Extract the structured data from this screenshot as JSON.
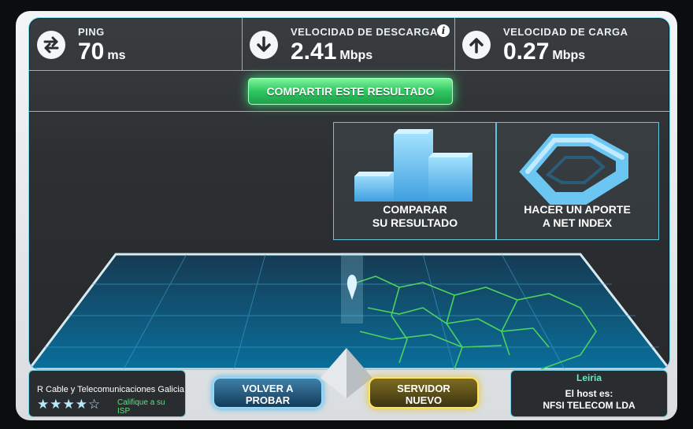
{
  "stats": {
    "ping": {
      "label": "PING",
      "value": "70",
      "unit": "ms",
      "icon": "swap-arrows-icon"
    },
    "download": {
      "label": "VELOCIDAD DE DESCARGA",
      "value": "2.41",
      "unit": "Mbps",
      "icon": "arrow-down-icon",
      "info": "i"
    },
    "upload": {
      "label": "VELOCIDAD DE CARGA",
      "value": "0.27",
      "unit": "Mbps",
      "icon": "arrow-up-icon"
    }
  },
  "share_button": "COMPARTIR ESTE RESULTADO",
  "panels": {
    "compare": {
      "line1": "COMPARAR",
      "line2": "SU RESULTADO",
      "icon": "bar-chart-icon"
    },
    "contribute": {
      "line1": "HACER UN APORTE",
      "line2": "A NET INDEX",
      "icon": "net-index-icon"
    }
  },
  "isp": {
    "name": "R Cable y Telecomunicaciones Galicia",
    "stars": "★★★★☆",
    "rate_line1": "Califique a su",
    "rate_line2": "ISP"
  },
  "buttons": {
    "again_line1": "VOLVER A",
    "again_line2": "PROBAR",
    "server_line1": "SERVIDOR",
    "server_line2": "NUEVO"
  },
  "host": {
    "city": "Leiria",
    "label": "El host es:",
    "name": "NFSI TELECOM LDA"
  },
  "colors": {
    "accent": "#5fc7e3",
    "share": "#2fc661",
    "server": "#ffe35a"
  }
}
